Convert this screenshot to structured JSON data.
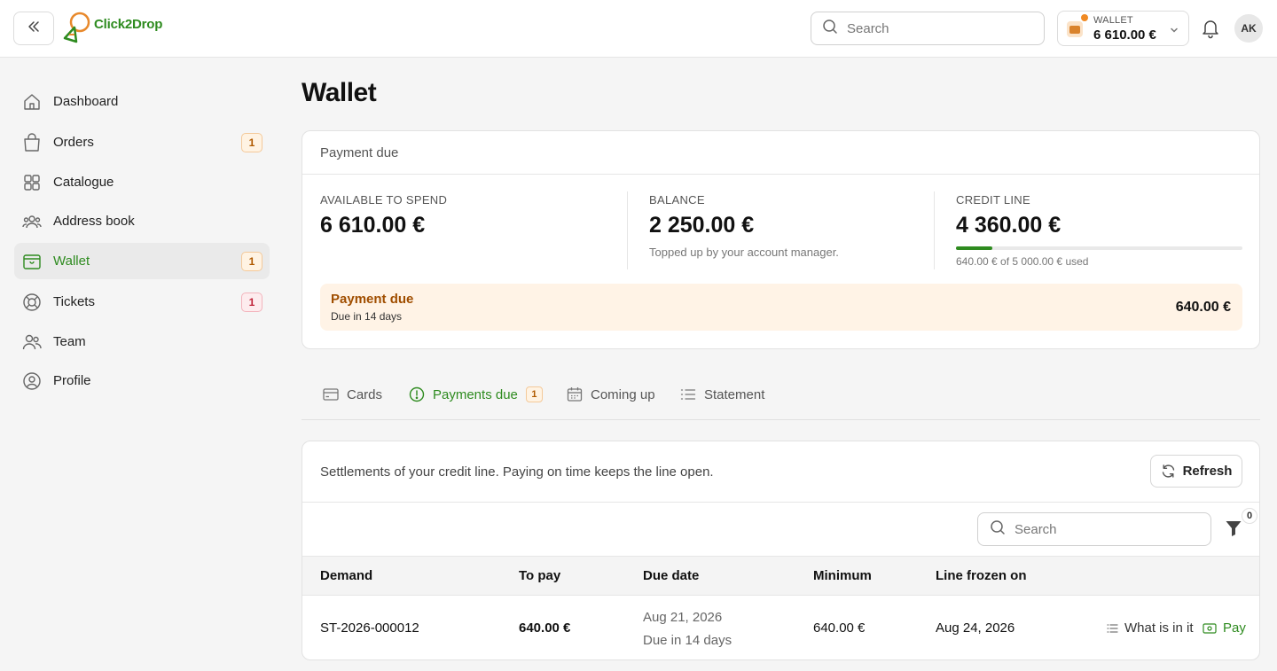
{
  "header": {
    "logo_text": "Click2Drop",
    "search_placeholder": "Search",
    "wallet_label": "WALLET",
    "wallet_amount": "6 610.00 €",
    "avatar_initials": "AK"
  },
  "sidebar": {
    "items": [
      {
        "label": "Dashboard",
        "icon": "home-icon"
      },
      {
        "label": "Orders",
        "icon": "shopping-bag-icon",
        "badge": "1"
      },
      {
        "label": "Catalogue",
        "icon": "grid-icon"
      },
      {
        "label": "Address book",
        "icon": "users-group-icon"
      },
      {
        "label": "Wallet",
        "icon": "wallet-icon",
        "badge": "1",
        "active": true
      },
      {
        "label": "Tickets",
        "icon": "lifebuoy-icon",
        "badge": "1"
      },
      {
        "label": "Team",
        "icon": "team-icon"
      },
      {
        "label": "Profile",
        "icon": "user-circle-icon"
      }
    ]
  },
  "page": {
    "title": "Wallet"
  },
  "summary": {
    "header": "Payment due",
    "available_label": "AVAILABLE TO SPEND",
    "available_value": "6 610.00 €",
    "balance_label": "BALANCE",
    "balance_value": "2 250.00 €",
    "balance_note": "Topped up by your account manager.",
    "credit_label": "CREDIT LINE",
    "credit_value": "4 360.00 €",
    "credit_used_fraction": 0.128,
    "credit_note": "640.00 € of 5 000.00 € used",
    "due_title": "Payment due",
    "due_subtitle": "Due in 14 days",
    "due_amount": "640.00 €"
  },
  "tabs": [
    {
      "label": "Cards",
      "icon": "card-icon"
    },
    {
      "label": "Payments due",
      "icon": "alert-circle-icon",
      "badge": "1",
      "active": true
    },
    {
      "label": "Coming up",
      "icon": "calendar-icon"
    },
    {
      "label": "Statement",
      "icon": "list-icon"
    }
  ],
  "list": {
    "description": "Settlements of your credit line. Paying on time keeps the line open.",
    "refresh_label": "Refresh",
    "search_placeholder": "Search",
    "filter_count": "0",
    "columns": [
      "Demand",
      "To pay",
      "Due date",
      "Minimum",
      "Line frozen on"
    ],
    "rows": [
      {
        "demand": "ST-2026-000012",
        "to_pay": "640.00 €",
        "due_date": "Aug 21, 2026",
        "due_relative": "Due in 14 days",
        "minimum": "640.00 €",
        "line_frozen_on": "Aug 24, 2026",
        "action_details": "What is in it",
        "action_pay": "Pay"
      }
    ]
  },
  "colors": {
    "accent_green": "#2e8b1f",
    "warning_orange": "#f08a24",
    "due_bg": "#fff3e6"
  }
}
